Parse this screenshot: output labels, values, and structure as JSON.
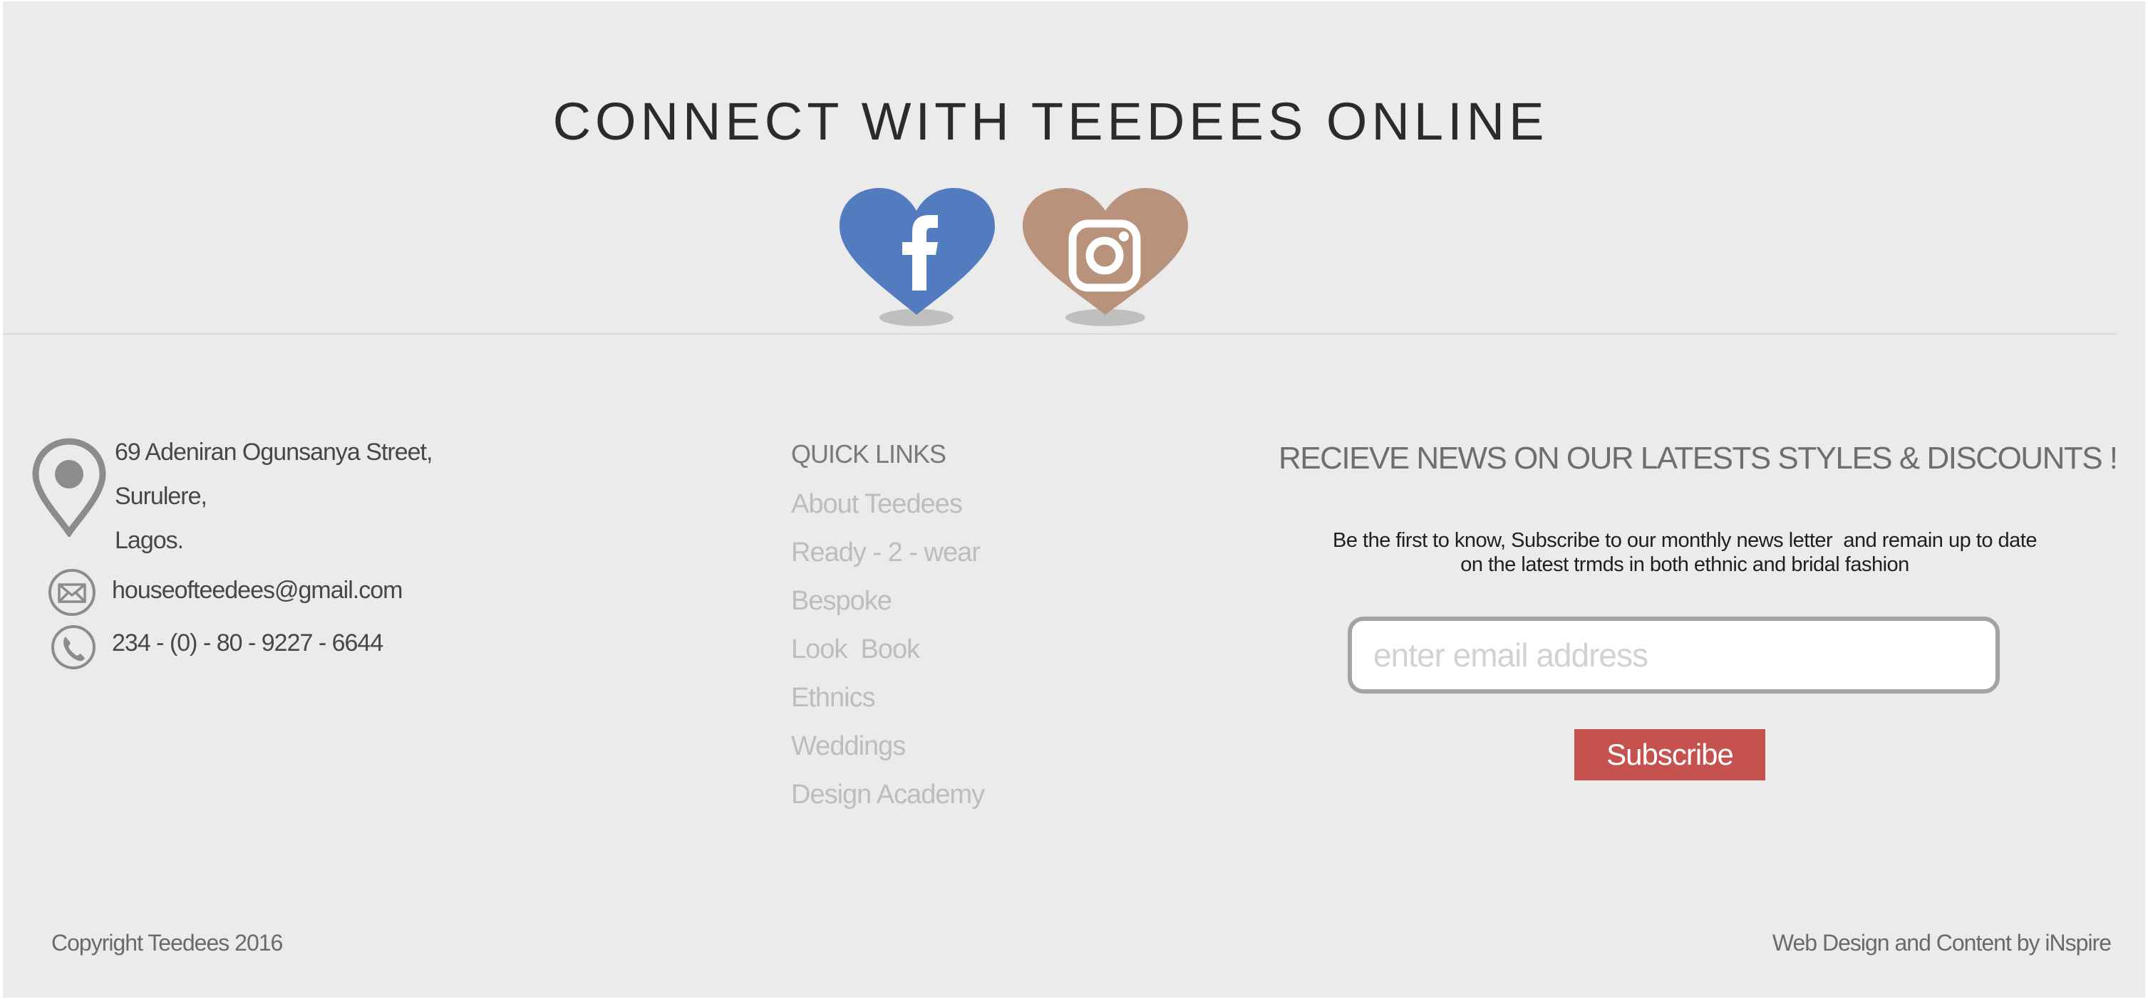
{
  "connect": {
    "title": "CONNECT WITH TEEDEES ONLINE",
    "social": [
      {
        "name": "facebook",
        "icon": "facebook-heart-icon",
        "color": "#537bbf"
      },
      {
        "name": "instagram",
        "icon": "instagram-heart-icon",
        "color": "#b9927b"
      }
    ]
  },
  "contact": {
    "address_lines": [
      "69 Adeniran Ogunsanya Street,",
      "Surulere,",
      "Lagos."
    ],
    "email": "houseofteedees@gmail.com",
    "phone": "234 - (0) - 80 - 9227 - 6644",
    "icons": [
      "location-pin-icon",
      "envelope-icon",
      "phone-icon"
    ]
  },
  "quick_links": {
    "heading": "QUICK LINKS",
    "items": [
      "About Teedees",
      "Ready - 2 - wear",
      "Bespoke",
      "Look  Book",
      "Ethnics",
      "Weddings",
      "Design Academy"
    ]
  },
  "newsletter": {
    "heading": "RECIEVE NEWS ON OUR LATESTS STYLES & DISCOUNTS !",
    "description_line1": "Be the first to know, Subscribe to our monthly news letter  and remain up to date",
    "description_line2": "on the latest trmds in both ethnic and bridal fashion",
    "email_placeholder": "enter email address",
    "email_value": "",
    "subscribe_label": "Subscribe",
    "accent_color": "#c5524e"
  },
  "footer": {
    "copyright": "Copyright Teedees 2016",
    "credit": "Web Design and Content by iNspire"
  }
}
